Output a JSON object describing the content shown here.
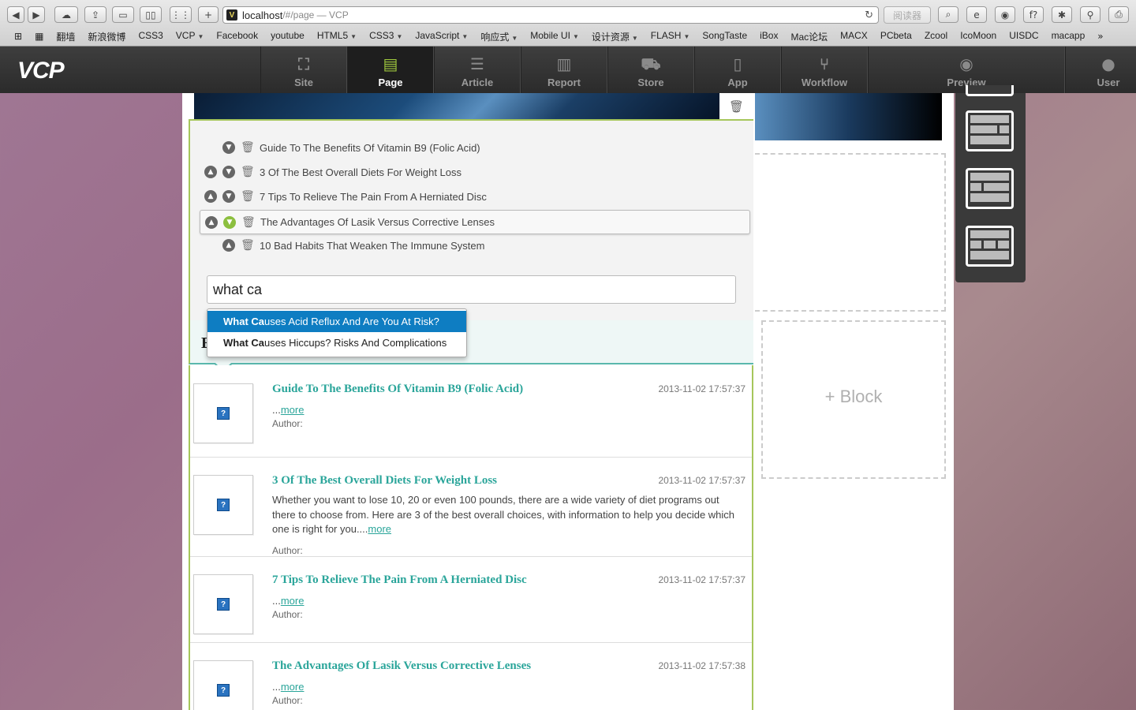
{
  "browser": {
    "url_host": "localhost",
    "url_rest": "/#/page — VCP",
    "reader_label": "阅读器",
    "bookmarks": [
      {
        "label": "翻墙",
        "menu": false
      },
      {
        "label": "新浪微博",
        "menu": false
      },
      {
        "label": "CSS3",
        "menu": false
      },
      {
        "label": "VCP",
        "menu": true
      },
      {
        "label": "Facebook",
        "menu": false
      },
      {
        "label": "youtube",
        "menu": false
      },
      {
        "label": "HTML5",
        "menu": true
      },
      {
        "label": "CSS3",
        "menu": true
      },
      {
        "label": "JavaScript",
        "menu": true
      },
      {
        "label": "响应式",
        "menu": true
      },
      {
        "label": "Mobile UI",
        "menu": true
      },
      {
        "label": "设计资源",
        "menu": true
      },
      {
        "label": "FLASH",
        "menu": true
      },
      {
        "label": "SongTaste",
        "menu": false
      },
      {
        "label": "iBox",
        "menu": false
      },
      {
        "label": "Mac论坛",
        "menu": false
      },
      {
        "label": "MACX",
        "menu": false
      },
      {
        "label": "PCbeta",
        "menu": false
      },
      {
        "label": "Zcool",
        "menu": false
      },
      {
        "label": "IcoMoon",
        "menu": false
      },
      {
        "label": "UISDC",
        "menu": false
      },
      {
        "label": "macapp",
        "menu": false
      }
    ]
  },
  "app": {
    "logo": "VCP",
    "nav": [
      {
        "label": "Site",
        "icon": "sitemap-icon",
        "glyph": "⛶",
        "active": false
      },
      {
        "label": "Page",
        "icon": "page-icon",
        "glyph": "▤",
        "active": true
      },
      {
        "label": "Article",
        "icon": "list-icon",
        "glyph": "☰",
        "active": false
      },
      {
        "label": "Report",
        "icon": "chart-icon",
        "glyph": "▥",
        "active": false
      },
      {
        "label": "Store",
        "icon": "cart-icon",
        "glyph": "⛟",
        "active": false
      },
      {
        "label": "App",
        "icon": "mobile-icon",
        "glyph": "▯",
        "active": false
      },
      {
        "label": "Workflow",
        "icon": "branch-icon",
        "glyph": "⑂",
        "active": false
      }
    ],
    "preview_label": "Preview",
    "user_label": "User"
  },
  "editor": {
    "items": [
      {
        "title": "Guide To The Benefits Of Vitamin B9 (Folic Acid)",
        "up": false,
        "down": true,
        "selected": false
      },
      {
        "title": "3 Of The Best Overall Diets For Weight Loss",
        "up": true,
        "down": true,
        "selected": false
      },
      {
        "title": "7 Tips To Relieve The Pain From A Herniated Disc",
        "up": true,
        "down": true,
        "selected": false
      },
      {
        "title": "The Advantages Of Lasik Versus Corrective Lenses",
        "up": true,
        "down": true,
        "selected": true
      },
      {
        "title": "10 Bad Habits That Weaken The Immune System",
        "up": true,
        "down": false,
        "selected": false
      }
    ],
    "search_value": "what ca",
    "suggestions": [
      {
        "match": "What Ca",
        "rest": "uses Acid Reflux And Are You At Risk?",
        "highlighted": true
      },
      {
        "match": "What Ca",
        "rest": "uses Hiccups? Risks And Complications",
        "highlighted": false
      }
    ],
    "section_heading_initial": "E"
  },
  "articles": [
    {
      "title": "Guide To The Benefits Of Vitamin B9 (Folic Acid)",
      "date": "2013-11-02 17:57:37",
      "excerpt": "...",
      "more": "more",
      "author": "Author:"
    },
    {
      "title": "3 Of The Best Overall Diets For Weight Loss",
      "date": "2013-11-02 17:57:37",
      "excerpt": "Whether you want to lose 10, 20 or even 100 pounds, there are a wide variety of diet programs out there to choose from. Here are 3 of the best overall choices, with information to help you decide which one is right for you....",
      "more": "more",
      "author": "Author:"
    },
    {
      "title": "7 Tips To Relieve The Pain From A Herniated Disc",
      "date": "2013-11-02 17:57:37",
      "excerpt": "...",
      "more": "more",
      "author": "Author:"
    },
    {
      "title": "The Advantages Of Lasik Versus Corrective Lenses",
      "date": "2013-11-02 17:57:38",
      "excerpt": "...",
      "more": "more",
      "author": "Author:"
    }
  ],
  "side": {
    "add_block_label": "+ Block"
  }
}
